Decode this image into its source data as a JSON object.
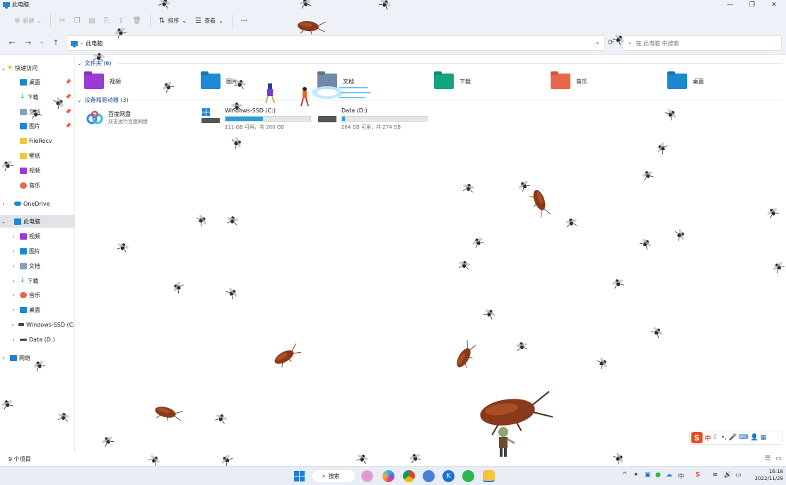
{
  "window": {
    "title": "此电脑"
  },
  "toolbar": {
    "new_label": "新建",
    "sort_label": "排序",
    "view_label": "查看",
    "more_label": "···"
  },
  "address": {
    "crumb": "此电脑",
    "search_placeholder": "在 此电脑 中搜索"
  },
  "sidebar": {
    "quick_access": "快速访问",
    "quick_items": [
      "桌面",
      "下载",
      "文档",
      "图片",
      "FileRecv",
      "壁纸",
      "视频",
      "音乐"
    ],
    "onedrive": "OneDrive",
    "this_pc": "此电脑",
    "pc_items": [
      "视频",
      "图片",
      "文档",
      "下载",
      "音乐",
      "桌面",
      "Windows-SSD (C:",
      "Data (D:)"
    ],
    "network": "网络"
  },
  "main": {
    "folders_header": "文件夹 (6)",
    "folders": [
      "视频",
      "图片",
      "文档",
      "下载",
      "音乐",
      "桌面"
    ],
    "devices_header": "设备和驱动器 (3)",
    "baidu": {
      "name": "百度网盘",
      "sub": "双击运行百度网盘"
    },
    "drives": [
      {
        "name": "Windows-SSD (C:)",
        "size": "111 GB 可用，共 200 GB",
        "used_fraction": 0.445
      },
      {
        "name": "Data (D:)",
        "size": "264 GB 可用，共 274 GB",
        "used_fraction": 0.036
      }
    ]
  },
  "status": {
    "count": "9 个项目"
  },
  "taskbar": {
    "search_label": "搜索",
    "time": "16:18",
    "date": "2022/11/29"
  },
  "ime": {
    "mode": "中"
  },
  "colors": {
    "accent": "#26a0da",
    "folder_video": "#9b3bd6",
    "folder_picture": "#1e8ad6",
    "folder_doc": "#6f8aa8",
    "folder_download": "#14a37f",
    "folder_music": "#e8674a",
    "folder_desktop": "#1c88d0"
  }
}
